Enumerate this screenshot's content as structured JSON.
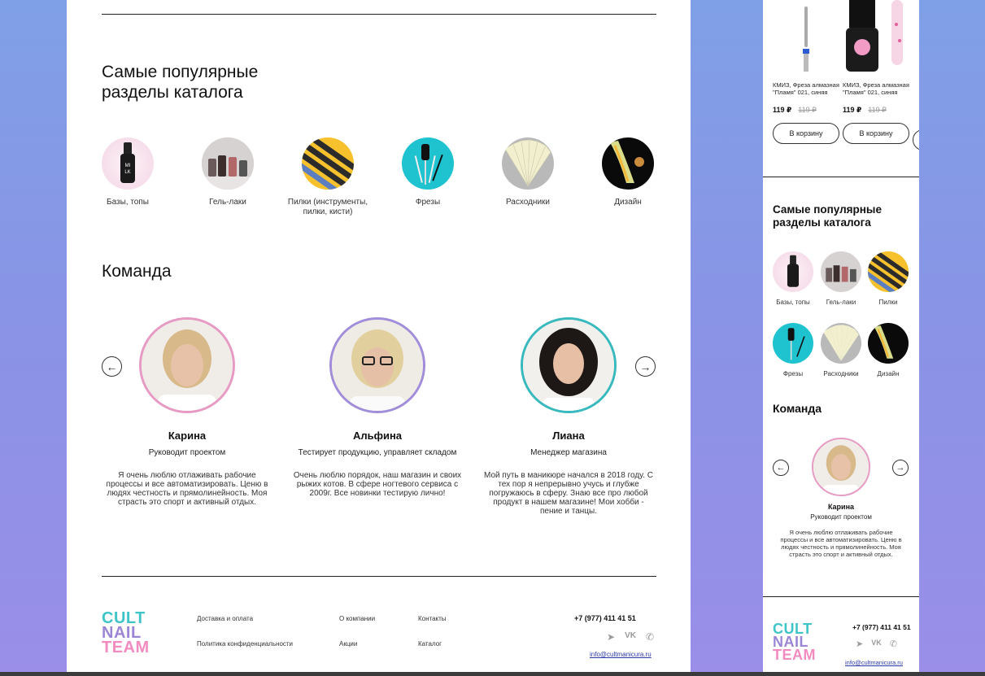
{
  "desktop": {
    "popular_title_1": "Самые популярные",
    "popular_title_2": "разделы каталога",
    "categories": [
      {
        "label": "Базы, топы",
        "icon": "gel-bottle-milk"
      },
      {
        "label": "Гель-лаки",
        "icon": "nail-polish-bottles"
      },
      {
        "label": "Пилки (инструменты, пилки, кисти)",
        "icon": "nail-files"
      },
      {
        "label": "Фрезы",
        "icon": "drill-bits"
      },
      {
        "label": "Расходники",
        "icon": "nail-tips-fan"
      },
      {
        "label": "Дизайн",
        "icon": "nail-design"
      }
    ],
    "team_title": "Команда",
    "team": [
      {
        "name": "Карина",
        "role": "Руководит проектом",
        "desc": "Я очень люблю отлаживать рабочие процессы и все автоматизировать. Ценю в людях честность и прямолинейность. Моя страсть это спорт и активный отдых."
      },
      {
        "name": "Альфина",
        "role": "Тестирует продукцию, управляет складом",
        "desc": "Очень люблю порядок, наш магазин и своих рыжих котов. В сфере ногтевого сервиса с 2009г. Все новинки тестирую лично!"
      },
      {
        "name": "Лиана",
        "role": "Менеджер магазина",
        "desc": "Мой путь в маникюре начался в 2018 году. С тех пор я непрерывно учусь и глубже погружаюсь в сферу. Знаю все про любой продукт в нашем магазине! Мои хобби - пение и танцы."
      }
    ],
    "footer": {
      "logo_1": "CULT",
      "logo_2": "NAIL",
      "logo_3": "TEAM",
      "links": [
        "Доставка и оплата",
        "Политика конфиденциальности",
        "О компании",
        "Акции",
        "Контакты",
        "Каталог"
      ],
      "phone": "+7 (977) 411 41 51",
      "email": "info@cultmanicura.ru"
    }
  },
  "mobile": {
    "products": [
      {
        "name": "КМИЗ, Фреза алмазная \"Пламя\" 021, синяя",
        "price": "119 ₽",
        "old_price": "119 ₽",
        "button": "В корзину"
      },
      {
        "name": "КМИЗ, Фреза алмазная \"Пламя\" 021, синяя",
        "price": "119 ₽",
        "old_price": "119 ₽",
        "button": "В корзину"
      }
    ],
    "popular_title_1": "Самые популярные",
    "popular_title_2": "разделы каталога",
    "categories": [
      "Базы, топы",
      "Гель-лаки",
      "Пилки",
      "Фрезы",
      "Расходники",
      "Дизайн"
    ],
    "team_title": "Команда",
    "member": {
      "name": "Карина",
      "role": "Руководит проектом",
      "desc": "Я очень люблю отлаживать рабочие процессы и все автоматизировать. Ценю в людях честность и прямолинейность. Моя страсть это спорт и активный отдых."
    },
    "footer": {
      "logo_1": "CULT",
      "logo_2": "NAIL",
      "logo_3": "TEAM",
      "phone": "+7 (977) 411 41 51",
      "email": "info@cultmanicura.ru"
    }
  },
  "colors": {
    "teal": "#3fc5c8",
    "purple": "#9b86d6",
    "pink": "#f28cc0"
  }
}
